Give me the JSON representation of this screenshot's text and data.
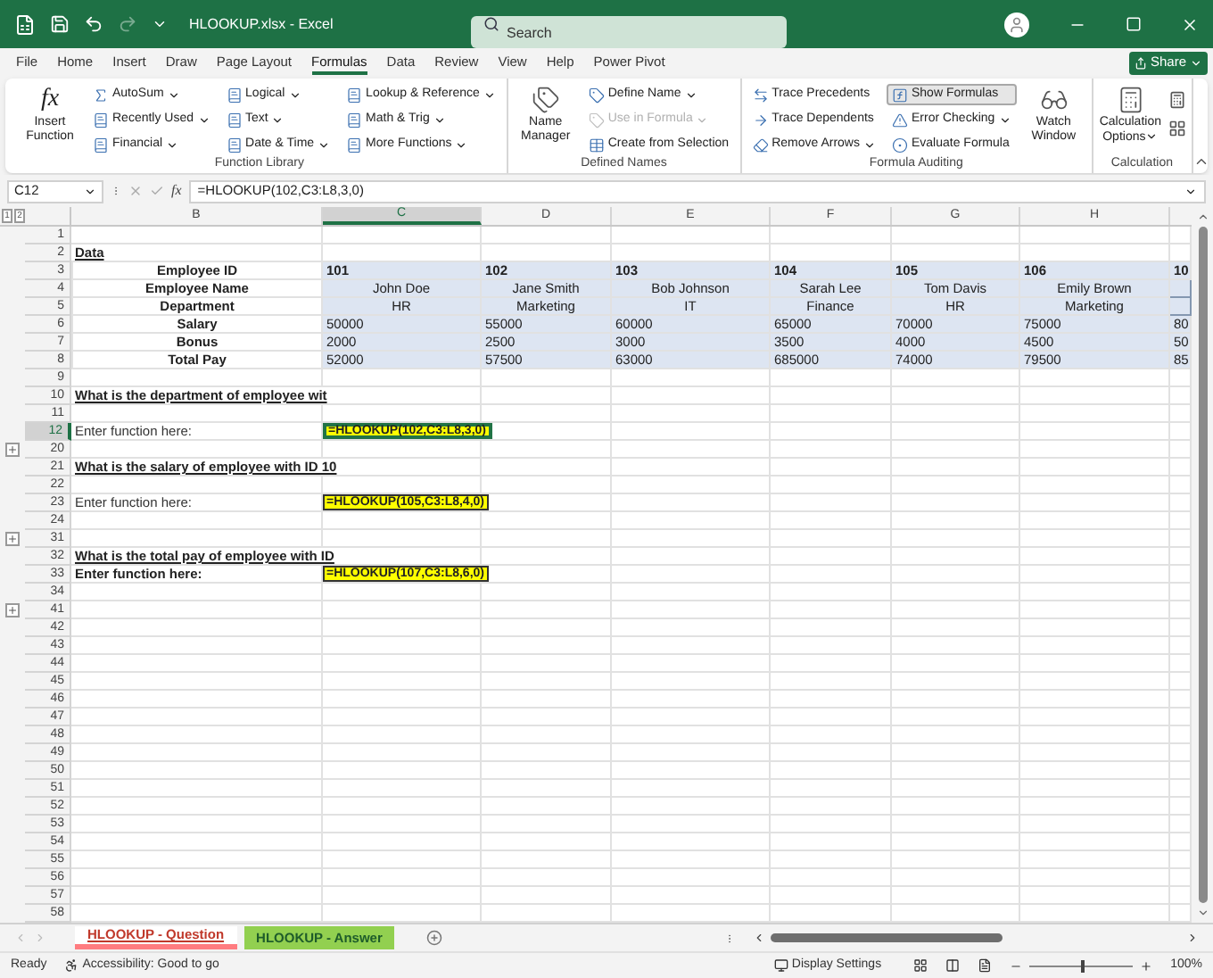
{
  "title_bar": {
    "title": "HLOOKUP.xlsx - Excel",
    "search_placeholder": "Search",
    "redo_disabled": true
  },
  "menu_tabs": [
    {
      "label": "File",
      "selected": false
    },
    {
      "label": "Home",
      "selected": false
    },
    {
      "label": "Insert",
      "selected": false
    },
    {
      "label": "Draw",
      "selected": false
    },
    {
      "label": "Page Layout",
      "selected": false
    },
    {
      "label": "Formulas",
      "selected": true
    },
    {
      "label": "Data",
      "selected": false
    },
    {
      "label": "Review",
      "selected": false
    },
    {
      "label": "View",
      "selected": false
    },
    {
      "label": "Help",
      "selected": false
    },
    {
      "label": "Power Pivot",
      "selected": false
    }
  ],
  "share_button": {
    "label": "Share"
  },
  "ribbon": {
    "groups": [
      {
        "label": "Function Library",
        "blocks": [
          {
            "kind": "big",
            "label": "Insert Function",
            "glyph": "fx",
            "menu": false
          },
          {
            "kind": "column",
            "items": [
              {
                "label": "AutoSum",
                "menu": true,
                "disabled": false,
                "on": false
              },
              {
                "label": "Recently Used",
                "menu": true,
                "disabled": false,
                "on": false
              },
              {
                "label": "Financial",
                "menu": true,
                "disabled": false,
                "on": false
              }
            ]
          },
          {
            "kind": "column",
            "items": [
              {
                "label": "Logical",
                "menu": true,
                "disabled": false,
                "on": false
              },
              {
                "label": "Text",
                "menu": true,
                "disabled": false,
                "on": false
              },
              {
                "label": "Date & Time",
                "menu": true,
                "disabled": false,
                "on": false
              }
            ]
          },
          {
            "kind": "column",
            "items": [
              {
                "label": "Lookup & Reference",
                "menu": true,
                "disabled": false,
                "on": false
              },
              {
                "label": "Math & Trig",
                "menu": true,
                "disabled": false,
                "on": false
              },
              {
                "label": "More Functions",
                "menu": true,
                "disabled": false,
                "on": false
              }
            ]
          }
        ]
      },
      {
        "label": "Defined Names",
        "blocks": [
          {
            "kind": "big",
            "label": "Name Manager",
            "menu": false
          },
          {
            "kind": "column",
            "items": [
              {
                "label": "Define Name",
                "menu": true,
                "disabled": false,
                "on": false
              },
              {
                "label": "Use in Formula",
                "menu": true,
                "disabled": true,
                "on": false
              },
              {
                "label": "Create from Selection",
                "menu": false,
                "disabled": false,
                "on": false
              }
            ]
          }
        ]
      },
      {
        "label": "Formula Auditing",
        "blocks": [
          {
            "kind": "column",
            "items": [
              {
                "label": "Trace Precedents",
                "menu": false,
                "disabled": false,
                "on": false
              },
              {
                "label": "Trace Dependents",
                "menu": false,
                "disabled": false,
                "on": false
              },
              {
                "label": "Remove Arrows",
                "menu": true,
                "disabled": false,
                "on": false
              }
            ]
          },
          {
            "kind": "column",
            "items": [
              {
                "label": "Show Formulas",
                "menu": false,
                "disabled": false,
                "on": true
              },
              {
                "label": "Error Checking",
                "menu": true,
                "disabled": false,
                "on": false
              },
              {
                "label": "Evaluate Formula",
                "menu": false,
                "disabled": false,
                "on": false
              }
            ]
          },
          {
            "kind": "big",
            "label": "Watch Window",
            "menu": false
          }
        ]
      },
      {
        "label": "Calculation",
        "blocks": [
          {
            "kind": "big",
            "label": "Calculation Options",
            "menu": true
          },
          {
            "kind": "icons"
          }
        ]
      }
    ]
  },
  "formula_bar": {
    "name_box": "C12",
    "fx_label": "fx",
    "formula": "=HLOOKUP(102,C3:L8,3,0)"
  },
  "outline_levels": [
    {
      "label": "1"
    },
    {
      "label": "2"
    }
  ],
  "columns": [
    {
      "label": "B",
      "selected": false
    },
    {
      "label": "C",
      "selected": true
    },
    {
      "label": "D",
      "selected": false
    },
    {
      "label": "E",
      "selected": false
    },
    {
      "label": "F",
      "selected": false
    },
    {
      "label": "G",
      "selected": false
    },
    {
      "label": "H",
      "selected": false
    }
  ],
  "rows": [
    {
      "n": "1",
      "kind": "blank",
      "selected": false,
      "toggle": false
    },
    {
      "n": "2",
      "kind": "title",
      "text": "Data",
      "selected": false,
      "toggle": false
    },
    {
      "n": "3",
      "kind": "table_id",
      "label": "Employee ID",
      "values": [
        "101",
        "102",
        "103",
        "104",
        "105",
        "106",
        "10"
      ],
      "selected": false,
      "toggle": false
    },
    {
      "n": "4",
      "kind": "table_text",
      "label": "Employee Name",
      "values": [
        "John Doe",
        "Jane Smith",
        "Bob Johnson",
        "Sarah Lee",
        "Tom Davis",
        "Emily Brown"
      ],
      "selected": false,
      "toggle": false
    },
    {
      "n": "5",
      "kind": "table_text",
      "label": "Department",
      "values": [
        "HR",
        "Marketing",
        "IT",
        "Finance",
        "HR",
        "Marketing"
      ],
      "selected": false,
      "toggle": false
    },
    {
      "n": "6",
      "kind": "table_number",
      "label": "Salary",
      "values": [
        "50000",
        "55000",
        "60000",
        "65000",
        "70000",
        "75000",
        "80"
      ],
      "selected": false,
      "toggle": false
    },
    {
      "n": "7",
      "kind": "table_number",
      "label": "Bonus",
      "values": [
        "2000",
        "2500",
        "3000",
        "3500",
        "4000",
        "4500",
        "50"
      ],
      "selected": false,
      "toggle": false
    },
    {
      "n": "8",
      "kind": "table_number",
      "label": "Total Pay",
      "values": [
        "52000",
        "57500",
        "63000",
        "685000",
        "74000",
        "79500",
        "85"
      ],
      "selected": false,
      "toggle": false
    },
    {
      "n": "9",
      "kind": "blank",
      "selected": false,
      "toggle": false
    },
    {
      "n": "10",
      "kind": "question",
      "text": "What is the department of employee wit",
      "selected": false,
      "toggle": false
    },
    {
      "n": "11",
      "kind": "blank",
      "selected": false,
      "toggle": false
    },
    {
      "n": "12",
      "kind": "prompt",
      "text": "Enter function here:",
      "formula": "=HLOOKUP(102,C3:L8,3,0)",
      "selected": true,
      "toggle": false
    },
    {
      "n": "20",
      "kind": "blank",
      "selected": false,
      "toggle": true
    },
    {
      "n": "21",
      "kind": "question",
      "text": "What is the salary of employee with ID 10",
      "selected": false,
      "toggle": false
    },
    {
      "n": "22",
      "kind": "blank",
      "selected": false,
      "toggle": false
    },
    {
      "n": "23",
      "kind": "prompt",
      "text": "Enter function here:",
      "formula": "=HLOOKUP(105,C3:L8,4,0)",
      "selected": false,
      "toggle": false
    },
    {
      "n": "24",
      "kind": "blank",
      "selected": false,
      "toggle": false
    },
    {
      "n": "31",
      "kind": "blank",
      "selected": false,
      "toggle": true
    },
    {
      "n": "32",
      "kind": "question",
      "text": "What is the total pay of employee with ID",
      "selected": false,
      "toggle": false
    },
    {
      "n": "33",
      "kind": "prompt_strong",
      "text": "Enter function here:",
      "formula": "=HLOOKUP(107,C3:L8,6,0)",
      "selected": false,
      "toggle": false
    },
    {
      "n": "34",
      "kind": "blank",
      "selected": false,
      "toggle": false
    },
    {
      "n": "41",
      "kind": "blank",
      "selected": false,
      "toggle": true
    },
    {
      "n": "42",
      "kind": "blank",
      "selected": false,
      "toggle": false
    },
    {
      "n": "43",
      "kind": "blank",
      "selected": false,
      "toggle": false
    },
    {
      "n": "44",
      "kind": "blank",
      "selected": false,
      "toggle": false
    },
    {
      "n": "45",
      "kind": "blank",
      "selected": false,
      "toggle": false
    },
    {
      "n": "46",
      "kind": "blank",
      "selected": false,
      "toggle": false
    },
    {
      "n": "47",
      "kind": "blank",
      "selected": false,
      "toggle": false
    },
    {
      "n": "48",
      "kind": "blank",
      "selected": false,
      "toggle": false
    },
    {
      "n": "49",
      "kind": "blank",
      "selected": false,
      "toggle": false
    },
    {
      "n": "50",
      "kind": "blank",
      "selected": false,
      "toggle": false
    },
    {
      "n": "51",
      "kind": "blank",
      "selected": false,
      "toggle": false
    },
    {
      "n": "52",
      "kind": "blank",
      "selected": false,
      "toggle": false
    },
    {
      "n": "53",
      "kind": "blank",
      "selected": false,
      "toggle": false
    },
    {
      "n": "54",
      "kind": "blank",
      "selected": false,
      "toggle": false
    },
    {
      "n": "55",
      "kind": "blank",
      "selected": false,
      "toggle": false
    },
    {
      "n": "56",
      "kind": "blank",
      "selected": false,
      "toggle": false
    },
    {
      "n": "57",
      "kind": "blank",
      "selected": false,
      "toggle": false
    },
    {
      "n": "58",
      "kind": "blank",
      "selected": false,
      "toggle": false
    }
  ],
  "sheet_tabs": [
    {
      "label": "HLOOKUP - Question",
      "selected": true,
      "color": "#ff7c80"
    },
    {
      "label": "HLOOKUP - Answer",
      "selected": false,
      "color": "#92d050"
    }
  ],
  "status_bar": {
    "status": "Ready",
    "accessibility": "Accessibility: Good to go",
    "display_settings": "Display Settings",
    "zoom": "100%",
    "zoom_slider": {
      "level": 0.5
    }
  }
}
